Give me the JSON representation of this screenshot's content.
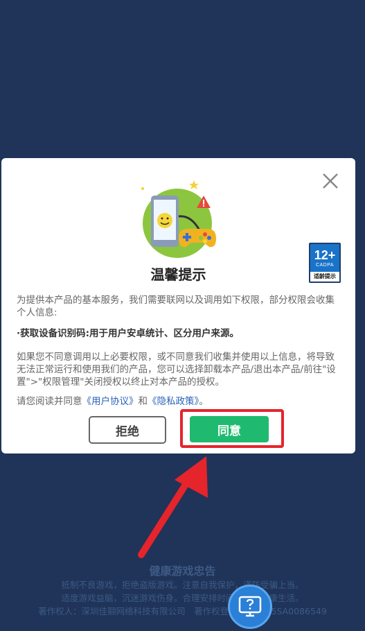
{
  "dialog": {
    "title": "温馨提示",
    "age_rating": {
      "number": "12+",
      "org": "CADPA",
      "caption": "适龄提示"
    },
    "para1": "为提供本产品的基本服务，我们需要联网以及调用如下权限，部分权限会收集个人信息:",
    "para2": "·获取设备识别码:用于用户安卓统计、区分用户来源。",
    "para3": "如果您不同意调用以上必要权限，或不同意我们收集并使用以上信息，将导致无法正常运行和使用我们的产品，您可以选择卸载本产品/退出本产品/前往\"设置\">\"权限管理\"关闭授权以终止对本产品的授权。",
    "para4_prefix": "请您阅读并同意",
    "user_agreement_link": "《用户协议》",
    "para4_and": "和",
    "privacy_link": "《隐私政策》",
    "para4_suffix": "。",
    "reject_label": "拒绝",
    "accept_label": "同意"
  },
  "footer": {
    "title": "健康游戏忠告",
    "line1": "抵制不良游戏，拒绝盗版游戏。注意自我保护，谨防受骗上当。",
    "line2": "适度游戏益脑，沉迷游戏伤身。合理安排时间，享受健康生活。",
    "line3": "著作权人：深圳佳翮网络科技有限公司　著作权登记号：2025SA0086549"
  },
  "colors": {
    "background": "#1f3458",
    "accept_green": "#1fba6f",
    "highlight_red": "#e5242c",
    "link_blue": "#2a63b8"
  },
  "icons": [
    "close-icon",
    "phone-gamepad-illustration",
    "age-rating-badge",
    "red-arrow-annotation",
    "help-question-icon"
  ]
}
